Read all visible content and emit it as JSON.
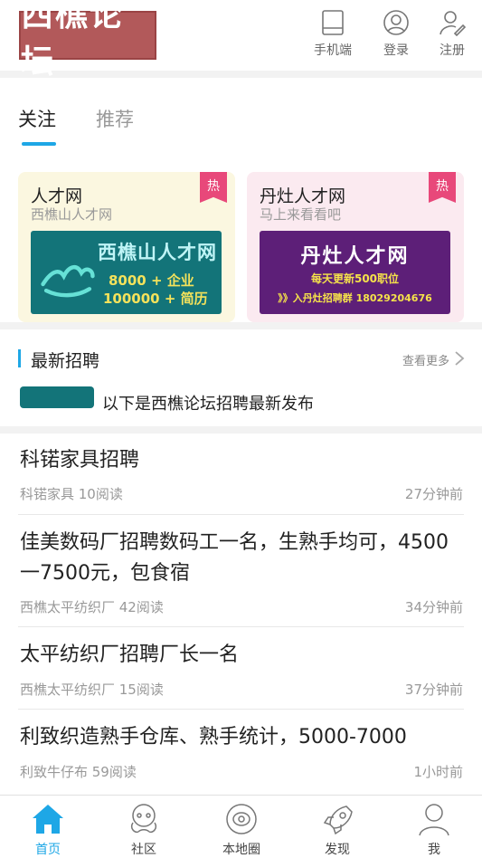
{
  "header": {
    "logo_text": "西樵论坛",
    "buttons": [
      {
        "label": "手机端",
        "icon": "phone-icon"
      },
      {
        "label": "登录",
        "icon": "user-circle-icon"
      },
      {
        "label": "注册",
        "icon": "user-edit-icon"
      }
    ]
  },
  "tabs": [
    {
      "label": "关注",
      "active": true
    },
    {
      "label": "推荐",
      "active": false
    }
  ],
  "cards": [
    {
      "title": "人才网",
      "subtitle": "西樵山人才网",
      "badge": "热",
      "banner": {
        "title": "西樵山人才网",
        "line1": "8000  +  企业",
        "line2": "100000  +  简历"
      }
    },
    {
      "title": "丹灶人才网",
      "subtitle": "马上来看看吧",
      "badge": "热",
      "banner": {
        "title": "丹灶人才网",
        "line1": "每天更新500职位",
        "line2": "》》入丹灶招聘群  18029204676"
      }
    }
  ],
  "recruit_section": {
    "title": "最新招聘",
    "more_label": "查看更多",
    "marquee_text": "以下是西樵论坛招聘最新发布"
  },
  "posts": [
    {
      "title": "科锘家具招聘",
      "meta": "科锘家具 10阅读",
      "time": "27分钟前"
    },
    {
      "title": "佳美数码厂招聘数码工一名，生熟手均可，4500一7500元，包食宿",
      "meta": "西樵太平纺织厂 42阅读",
      "time": "34分钟前"
    },
    {
      "title": "太平纺织厂招聘厂长一名",
      "meta": "西樵太平纺织厂 15阅读",
      "time": "37分钟前"
    },
    {
      "title": "利致织造熟手仓库、熟手统计，5000-7000",
      "meta": "利致牛仔布 59阅读",
      "time": "1小时前"
    }
  ],
  "tabbar": [
    {
      "label": "首页",
      "icon": "home-icon",
      "active": true
    },
    {
      "label": "社区",
      "icon": "community-icon",
      "active": false
    },
    {
      "label": "本地圈",
      "icon": "local-circle-icon",
      "active": false
    },
    {
      "label": "发现",
      "icon": "rocket-icon",
      "active": false
    },
    {
      "label": "我",
      "icon": "profile-icon",
      "active": false
    }
  ],
  "colors": {
    "accent": "#1ea7e6",
    "hot_badge": "#e8487a",
    "logo_bg": "#b2595a"
  }
}
